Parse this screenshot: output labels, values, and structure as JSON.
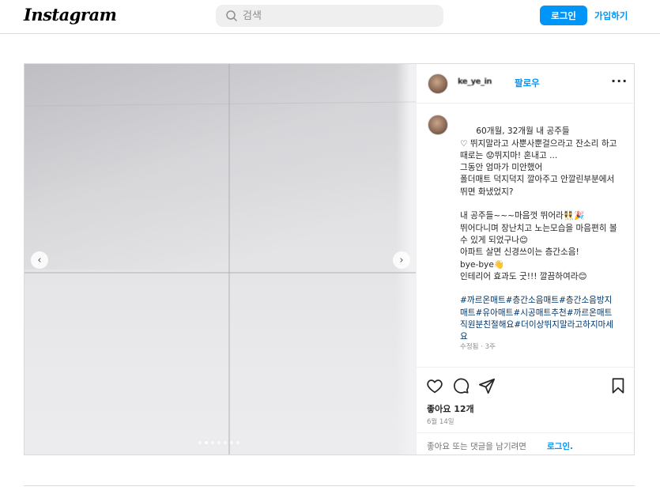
{
  "header": {
    "logo": "Instagram",
    "search_placeholder": "검색",
    "login_label": "로그인",
    "signup_label": "가입하기"
  },
  "post": {
    "username": "ke_ye_in",
    "follow_label": "팔로우",
    "more_label": "···",
    "caption": "60개월, 32개월 내 공주들\n♡ 뛰지말라고 사뿐사뿐걸으라고 잔소리 하고\n때로는 😟뛰지마! 혼내고 ...\n그동안 엄마가 미안했어\n폴더매트 덕지덕지 깔아주고 안깔린부분에서 뛰면 화냈었지?\n\n내 공주들~~~마음껏 뛰어라👯🎉\n뛰어다니며 장난치고 노는모습을 마음편히 볼수 있게 되었구나😊\n아파트 살면 신경쓰이는 층간소음!\nbye-bye👋\n인테리어 효과도 굿!!! 깔끔하여라😊",
    "hashtags": "#까르온매트#층간소음매트#층간소음방지매트#유아매트#시공매트추천#까르온매트직원분친절해요#더이상뛰지말라고하지마세요",
    "edited": "수정됨 · 3주",
    "likes": "좋아요 12개",
    "date": "6월 14일",
    "comment_prompt": "좋아요 또는 댓글을 남기려면",
    "comment_login": "로그인.",
    "carousel_slide_index": 2,
    "carousel_total": 7
  },
  "icons": {
    "heart": "heart-icon",
    "comment": "comment-icon",
    "share": "share-icon",
    "save": "bookmark-icon",
    "search": "search-icon"
  }
}
